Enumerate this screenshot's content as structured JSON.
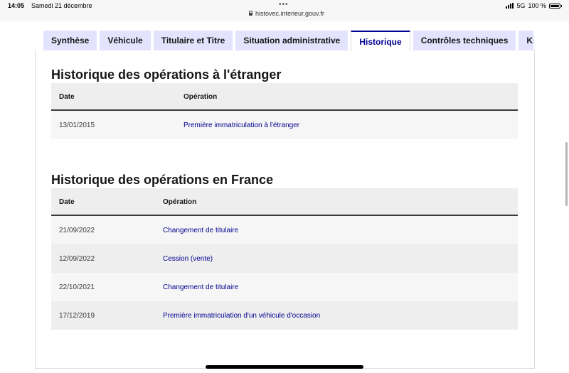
{
  "status_bar": {
    "time": "14:05",
    "date": "Samedi 21 décembre",
    "url": "histovec.interieur.gouv.fr",
    "network": "5G",
    "battery": "100 %",
    "battery_level": 1.0
  },
  "tabs": [
    {
      "label": "Synthèse",
      "active": false
    },
    {
      "label": "Véhicule",
      "active": false
    },
    {
      "label": "Titulaire et Titre",
      "active": false
    },
    {
      "label": "Situation administrative",
      "active": false
    },
    {
      "label": "Historique",
      "active": true
    },
    {
      "label": "Contrôles techniques",
      "active": false
    },
    {
      "label": "Kilométrage",
      "active": false
    }
  ],
  "abroad": {
    "title": "Historique des opérations à l'étranger",
    "headers": {
      "date": "Date",
      "operation": "Opération"
    },
    "rows": [
      {
        "date": "13/01/2015",
        "operation": "Première immatriculation à l'étranger"
      }
    ]
  },
  "france": {
    "title": "Historique des opérations en France",
    "headers": {
      "date": "Date",
      "operation": "Opération"
    },
    "rows": [
      {
        "date": "21/09/2022",
        "operation": "Changement de titulaire"
      },
      {
        "date": "12/09/2022",
        "operation": "Cession (vente)"
      },
      {
        "date": "22/10/2021",
        "operation": "Changement de titulaire"
      },
      {
        "date": "17/12/2019",
        "operation": "Première immatriculation d'un véhicule d'occasion"
      }
    ]
  },
  "colors": {
    "accent": "#000091",
    "tab_bg": "#e3e3fd",
    "header_bg": "#eeeeee"
  }
}
